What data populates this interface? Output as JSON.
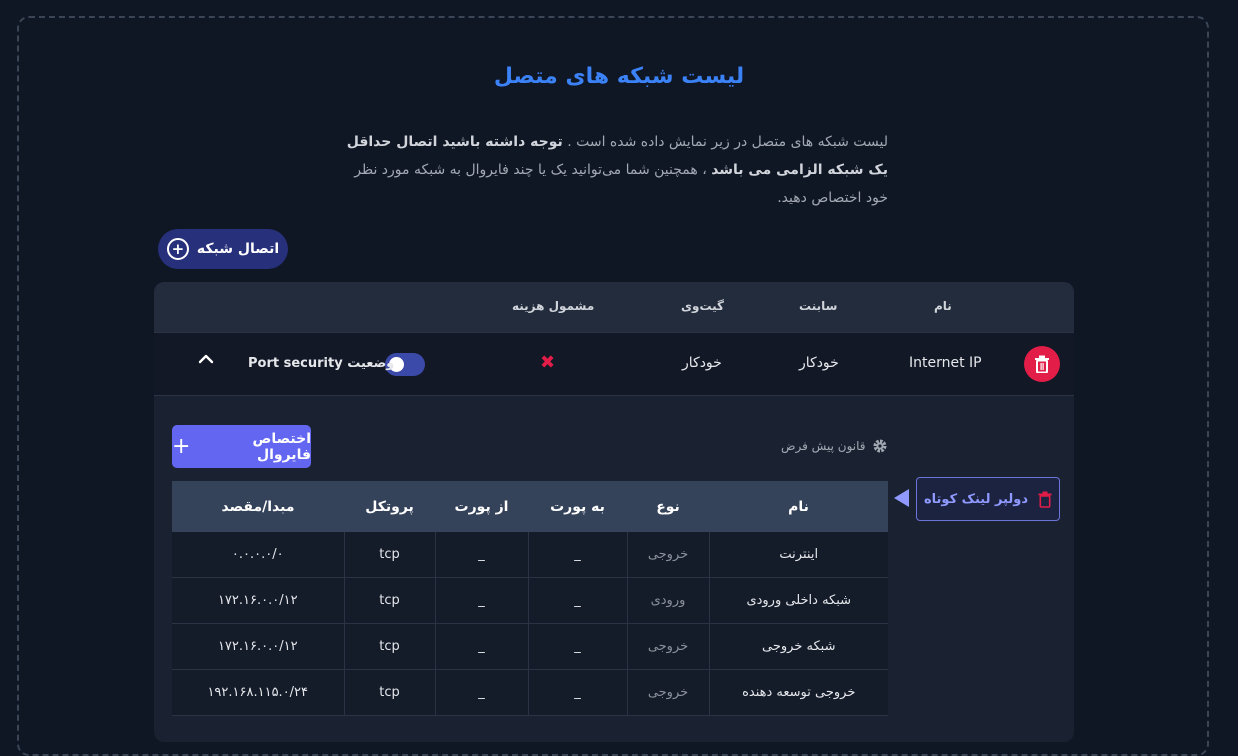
{
  "page": {
    "title": "لیست شبکه های متصل",
    "description_plain_1": "لیست شبکه های متصل در زیر نمایش داده شده است . ",
    "description_bold_1": "توجه داشته باشید اتصال حداقل یک شبکه الزامی می باشد",
    "description_plain_2": " ، همچنین شما می‌توانید یک یا چند فایروال به شبکه مورد نظر خود اختصاص دهید."
  },
  "connect_button": {
    "label": "اتصال شبکه"
  },
  "network_table": {
    "headers": {
      "name": "نام",
      "subnet": "سابنت",
      "gateway": "گیت‌وی",
      "billing": "مشمول هزینه"
    },
    "row": {
      "name": "Internet IP",
      "subnet": "خودکار",
      "gateway": "خودکار",
      "port_security_label": "Port security",
      "status_label": "وضعیت"
    }
  },
  "firewall": {
    "assign_button": "اختصاص فایروال",
    "default_rule": "قانون پیش فرض",
    "tag_name": "دولپر لینک کوتاه",
    "rules_headers": [
      "نام",
      "نوع",
      "به پورت",
      "از پورت",
      "پروتکل",
      "مبدا/مقصد"
    ],
    "rules": [
      {
        "name": "اینترنت",
        "type": "خروجی",
        "to_port": "_",
        "from_port": "_",
        "protocol": "tcp",
        "address": "۰.۰.۰.۰/۰"
      },
      {
        "name": "شبکه داخلی ورودی",
        "type": "ورودی",
        "to_port": "_",
        "from_port": "_",
        "protocol": "tcp",
        "address": "۱۷۲.۱۶.۰.۰/۱۲"
      },
      {
        "name": "شبکه خروجی",
        "type": "خروجی",
        "to_port": "_",
        "from_port": "_",
        "protocol": "tcp",
        "address": "۱۷۲.۱۶.۰.۰/۱۲"
      },
      {
        "name": "خروجی توسعه دهنده",
        "type": "خروجی",
        "to_port": "_",
        "from_port": "_",
        "protocol": "tcp",
        "address": "۱۹۲.۱۶۸.۱۱۵.۰/۲۴"
      }
    ]
  },
  "colors": {
    "accent": "#3b82f6",
    "primary_button": "#6366f1",
    "danger": "#e11d48"
  }
}
